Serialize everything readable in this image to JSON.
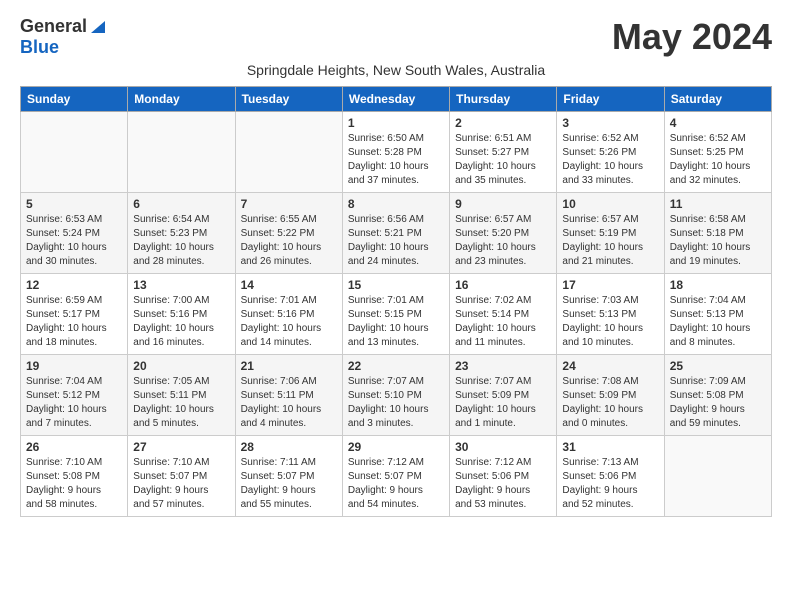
{
  "logo": {
    "line1": "General",
    "line2": "Blue"
  },
  "title": "May 2024",
  "subtitle": "Springdale Heights, New South Wales, Australia",
  "headers": [
    "Sunday",
    "Monday",
    "Tuesday",
    "Wednesday",
    "Thursday",
    "Friday",
    "Saturday"
  ],
  "weeks": [
    [
      {
        "day": "",
        "info": ""
      },
      {
        "day": "",
        "info": ""
      },
      {
        "day": "",
        "info": ""
      },
      {
        "day": "1",
        "info": "Sunrise: 6:50 AM\nSunset: 5:28 PM\nDaylight: 10 hours\nand 37 minutes."
      },
      {
        "day": "2",
        "info": "Sunrise: 6:51 AM\nSunset: 5:27 PM\nDaylight: 10 hours\nand 35 minutes."
      },
      {
        "day": "3",
        "info": "Sunrise: 6:52 AM\nSunset: 5:26 PM\nDaylight: 10 hours\nand 33 minutes."
      },
      {
        "day": "4",
        "info": "Sunrise: 6:52 AM\nSunset: 5:25 PM\nDaylight: 10 hours\nand 32 minutes."
      }
    ],
    [
      {
        "day": "5",
        "info": "Sunrise: 6:53 AM\nSunset: 5:24 PM\nDaylight: 10 hours\nand 30 minutes."
      },
      {
        "day": "6",
        "info": "Sunrise: 6:54 AM\nSunset: 5:23 PM\nDaylight: 10 hours\nand 28 minutes."
      },
      {
        "day": "7",
        "info": "Sunrise: 6:55 AM\nSunset: 5:22 PM\nDaylight: 10 hours\nand 26 minutes."
      },
      {
        "day": "8",
        "info": "Sunrise: 6:56 AM\nSunset: 5:21 PM\nDaylight: 10 hours\nand 24 minutes."
      },
      {
        "day": "9",
        "info": "Sunrise: 6:57 AM\nSunset: 5:20 PM\nDaylight: 10 hours\nand 23 minutes."
      },
      {
        "day": "10",
        "info": "Sunrise: 6:57 AM\nSunset: 5:19 PM\nDaylight: 10 hours\nand 21 minutes."
      },
      {
        "day": "11",
        "info": "Sunrise: 6:58 AM\nSunset: 5:18 PM\nDaylight: 10 hours\nand 19 minutes."
      }
    ],
    [
      {
        "day": "12",
        "info": "Sunrise: 6:59 AM\nSunset: 5:17 PM\nDaylight: 10 hours\nand 18 minutes."
      },
      {
        "day": "13",
        "info": "Sunrise: 7:00 AM\nSunset: 5:16 PM\nDaylight: 10 hours\nand 16 minutes."
      },
      {
        "day": "14",
        "info": "Sunrise: 7:01 AM\nSunset: 5:16 PM\nDaylight: 10 hours\nand 14 minutes."
      },
      {
        "day": "15",
        "info": "Sunrise: 7:01 AM\nSunset: 5:15 PM\nDaylight: 10 hours\nand 13 minutes."
      },
      {
        "day": "16",
        "info": "Sunrise: 7:02 AM\nSunset: 5:14 PM\nDaylight: 10 hours\nand 11 minutes."
      },
      {
        "day": "17",
        "info": "Sunrise: 7:03 AM\nSunset: 5:13 PM\nDaylight: 10 hours\nand 10 minutes."
      },
      {
        "day": "18",
        "info": "Sunrise: 7:04 AM\nSunset: 5:13 PM\nDaylight: 10 hours\nand 8 minutes."
      }
    ],
    [
      {
        "day": "19",
        "info": "Sunrise: 7:04 AM\nSunset: 5:12 PM\nDaylight: 10 hours\nand 7 minutes."
      },
      {
        "day": "20",
        "info": "Sunrise: 7:05 AM\nSunset: 5:11 PM\nDaylight: 10 hours\nand 5 minutes."
      },
      {
        "day": "21",
        "info": "Sunrise: 7:06 AM\nSunset: 5:11 PM\nDaylight: 10 hours\nand 4 minutes."
      },
      {
        "day": "22",
        "info": "Sunrise: 7:07 AM\nSunset: 5:10 PM\nDaylight: 10 hours\nand 3 minutes."
      },
      {
        "day": "23",
        "info": "Sunrise: 7:07 AM\nSunset: 5:09 PM\nDaylight: 10 hours\nand 1 minute."
      },
      {
        "day": "24",
        "info": "Sunrise: 7:08 AM\nSunset: 5:09 PM\nDaylight: 10 hours\nand 0 minutes."
      },
      {
        "day": "25",
        "info": "Sunrise: 7:09 AM\nSunset: 5:08 PM\nDaylight: 9 hours\nand 59 minutes."
      }
    ],
    [
      {
        "day": "26",
        "info": "Sunrise: 7:10 AM\nSunset: 5:08 PM\nDaylight: 9 hours\nand 58 minutes."
      },
      {
        "day": "27",
        "info": "Sunrise: 7:10 AM\nSunset: 5:07 PM\nDaylight: 9 hours\nand 57 minutes."
      },
      {
        "day": "28",
        "info": "Sunrise: 7:11 AM\nSunset: 5:07 PM\nDaylight: 9 hours\nand 55 minutes."
      },
      {
        "day": "29",
        "info": "Sunrise: 7:12 AM\nSunset: 5:07 PM\nDaylight: 9 hours\nand 54 minutes."
      },
      {
        "day": "30",
        "info": "Sunrise: 7:12 AM\nSunset: 5:06 PM\nDaylight: 9 hours\nand 53 minutes."
      },
      {
        "day": "31",
        "info": "Sunrise: 7:13 AM\nSunset: 5:06 PM\nDaylight: 9 hours\nand 52 minutes."
      },
      {
        "day": "",
        "info": ""
      }
    ]
  ]
}
